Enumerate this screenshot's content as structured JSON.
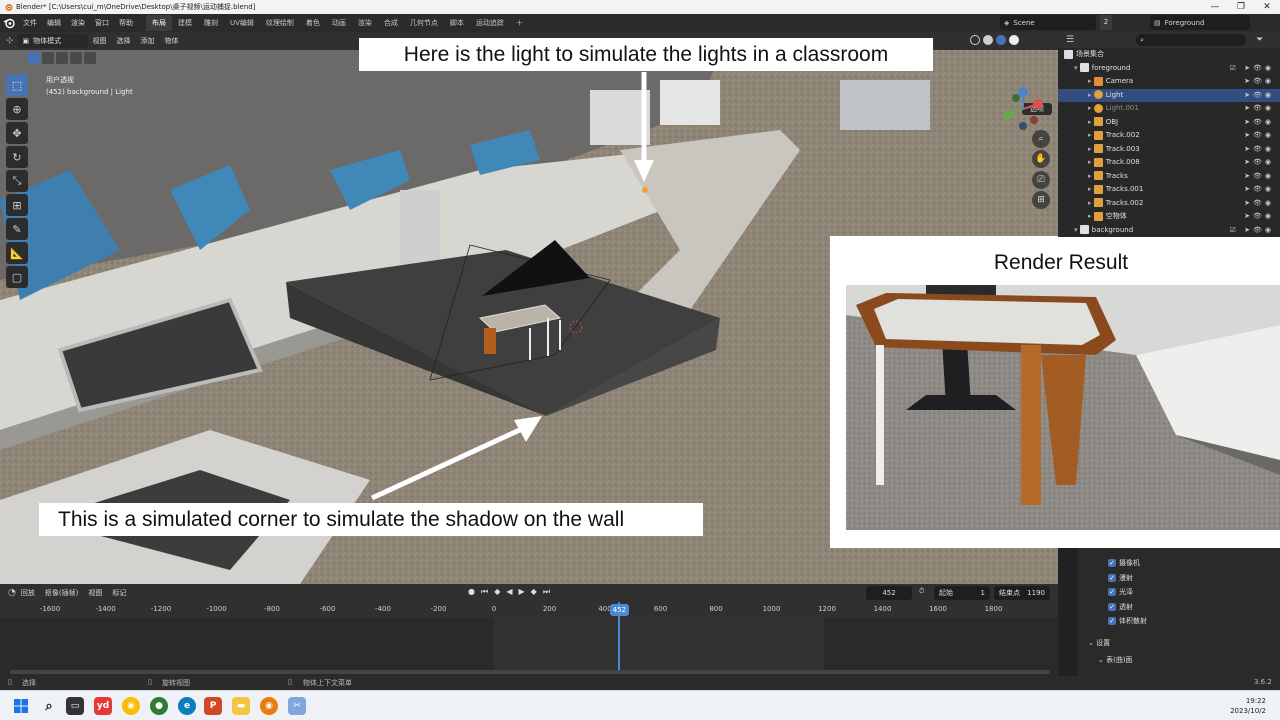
{
  "titlebar": {
    "title": "Blender* [C:\\Users\\cui_m\\OneDrive\\Desktop\\桌子视频\\运动捕捉.blend]"
  },
  "menus": [
    "文件",
    "编辑",
    "渲染",
    "窗口",
    "帮助"
  ],
  "workspaces": [
    {
      "label": "布局",
      "active": true
    },
    {
      "label": "建模",
      "active": false
    },
    {
      "label": "雕刻",
      "active": false
    },
    {
      "label": "UV编辑",
      "active": false
    },
    {
      "label": "纹理绘制",
      "active": false
    },
    {
      "label": "着色",
      "active": false
    },
    {
      "label": "动画",
      "active": false
    },
    {
      "label": "渲染",
      "active": false
    },
    {
      "label": "合成",
      "active": false
    },
    {
      "label": "几何节点",
      "active": false
    },
    {
      "label": "脚本",
      "active": false
    },
    {
      "label": "运动追踪",
      "active": false
    }
  ],
  "scene": {
    "name": "Scene",
    "count": "2"
  },
  "view_layer": {
    "name": "Foreground"
  },
  "viewport": {
    "mode": "物体模式",
    "menus": [
      "视图",
      "选择",
      "添加",
      "物体"
    ],
    "view_name": "用户透视",
    "object_info": "(452) background | Light",
    "select_label": "选项"
  },
  "annotations": {
    "top": "Here is the light to simulate the lights in a classroom",
    "bottom": "This is a simulated corner to simulate the shadow on the wall",
    "render_title": "Render Result"
  },
  "outliner": {
    "root": "场景集合",
    "items": [
      {
        "label": "foreground",
        "level": 1,
        "type": "collection",
        "selected": false,
        "dim": false
      },
      {
        "label": "Camera",
        "level": 2,
        "type": "camera",
        "selected": false,
        "dim": false
      },
      {
        "label": "Light",
        "level": 2,
        "type": "light",
        "selected": true,
        "dim": false
      },
      {
        "label": "Light.001",
        "level": 2,
        "type": "light",
        "selected": false,
        "dim": true
      },
      {
        "label": "OBJ",
        "level": 2,
        "type": "empty",
        "selected": false,
        "dim": false
      },
      {
        "label": "Track.002",
        "level": 2,
        "type": "empty",
        "selected": false,
        "dim": false
      },
      {
        "label": "Track.003",
        "level": 2,
        "type": "empty",
        "selected": false,
        "dim": false
      },
      {
        "label": "Track.008",
        "level": 2,
        "type": "empty",
        "selected": false,
        "dim": false
      },
      {
        "label": "Tracks",
        "level": 2,
        "type": "mesh",
        "selected": false,
        "dim": false
      },
      {
        "label": "Tracks.001",
        "level": 2,
        "type": "mesh",
        "selected": false,
        "dim": false
      },
      {
        "label": "Tracks.002",
        "level": 2,
        "type": "mesh",
        "selected": false,
        "dim": false
      },
      {
        "label": "空物体",
        "level": 2,
        "type": "empty",
        "selected": false,
        "dim": false
      },
      {
        "label": "background",
        "level": 1,
        "type": "collection",
        "selected": false,
        "dim": false
      }
    ]
  },
  "properties": {
    "checks": [
      "摄像机",
      "漫射",
      "光泽",
      "透射",
      "体积散射"
    ],
    "section": "设置",
    "subsection": "表(曲)面"
  },
  "timeline": {
    "menus": [
      "回放",
      "抠像(插帧)",
      "视图",
      "标记"
    ],
    "ticks": [
      -1600,
      -1400,
      -1200,
      -1000,
      -800,
      -600,
      -400,
      -200,
      0,
      200,
      400,
      600,
      800,
      1000,
      1200,
      1400,
      1600,
      1800
    ],
    "current_frame": "452",
    "start_label": "起始",
    "start": "1",
    "end_label": "结束点",
    "end": "1190"
  },
  "statusbar": {
    "left": "选择",
    "middle": "旋转视图",
    "right": "物体上下文菜单",
    "version": "3.6.2"
  },
  "taskbar": {
    "time": "19:22",
    "date": "2023/10/2"
  },
  "colors": {
    "accent": "#4772b3",
    "selected_row": "#334d80",
    "playhead": "#4d8ad6",
    "callout_bg": "#ffffff"
  }
}
